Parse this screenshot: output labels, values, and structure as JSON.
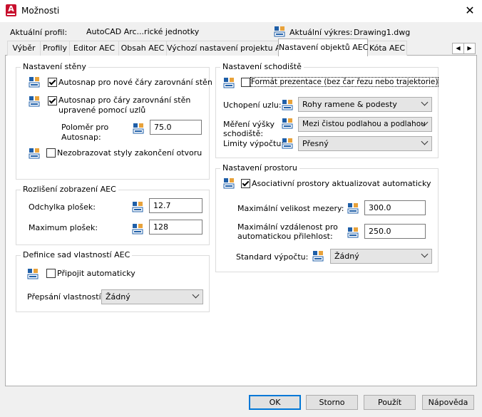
{
  "window": {
    "title": "Možnosti",
    "close_glyph": "✕"
  },
  "profile": {
    "label": "Aktuální profil:",
    "value": "AutoCAD Arc...rické jednotky"
  },
  "drawing": {
    "label": "Aktuální výkres:",
    "value": "Drawing1.dwg"
  },
  "tabs": [
    {
      "label": "Výběr"
    },
    {
      "label": "Profily"
    },
    {
      "label": "Editor AEC"
    },
    {
      "label": "Obsah AEC"
    },
    {
      "label": "Výchozí nastavení projektu AEC"
    },
    {
      "label": "Nastavení objektů AEC"
    },
    {
      "label": "Kóta AEC"
    }
  ],
  "tab_scroll": {
    "left": "◀",
    "right": "▶"
  },
  "wall": {
    "title": "Nastavení stěny",
    "autosnap_new": "Autosnap pro nové čáry zarovnání stěn",
    "autosnap_grip_1": "Autosnap pro čáry zarovnání stěn",
    "autosnap_grip_2": "upravené pomocí uzlů",
    "radius_label_1": "Poloměr pro",
    "radius_label_2": "Autosnap:",
    "radius_value": "75.0",
    "hide_styles": "Nezobrazovat styly zakončení otvoru"
  },
  "resolution": {
    "title": "Rozlišení zobrazení AEC",
    "deviation_label": "Odchylka plošek:",
    "deviation_value": "12.7",
    "max_label": "Maximum plošek:",
    "max_value": "128"
  },
  "propsets": {
    "title": "Definice sad vlastností AEC",
    "attach_auto": "Připojit automaticky",
    "override_label": "Přepsání vlastností",
    "override_value": "Žádný"
  },
  "stair": {
    "title": "Nastavení schodiště",
    "presentation": "Formát prezentace (bez čar řezu nebo trajektorie)",
    "node_label": "Uchopení uzlu:",
    "node_value": "Rohy ramene & podesty",
    "height_label_1": "Měření výšky",
    "height_label_2": "schodiště:",
    "height_value": "Mezi čistou podlahou a podlahou",
    "limits_label": "Limity výpočtu:",
    "limits_value": "Přesný"
  },
  "space": {
    "title": "Nastavení prostoru",
    "assoc": "Asociativní prostory aktualizovat automaticky",
    "gap_label": "Maximální velikost mezery:",
    "gap_value": "300.0",
    "dist_label_1": "Maximální vzdálenost pro",
    "dist_label_2": "automatickou přilehlost:",
    "dist_value": "250.0",
    "standard_label": "Standard výpočtu:",
    "standard_value": "Žádný"
  },
  "buttons": {
    "ok": "OK",
    "cancel": "Storno",
    "apply": "Použít",
    "help": "Nápověda"
  },
  "colors": {
    "accent": "#0078d7",
    "icon_blue": "#1f5fa8",
    "icon_orange": "#e8a23a"
  }
}
